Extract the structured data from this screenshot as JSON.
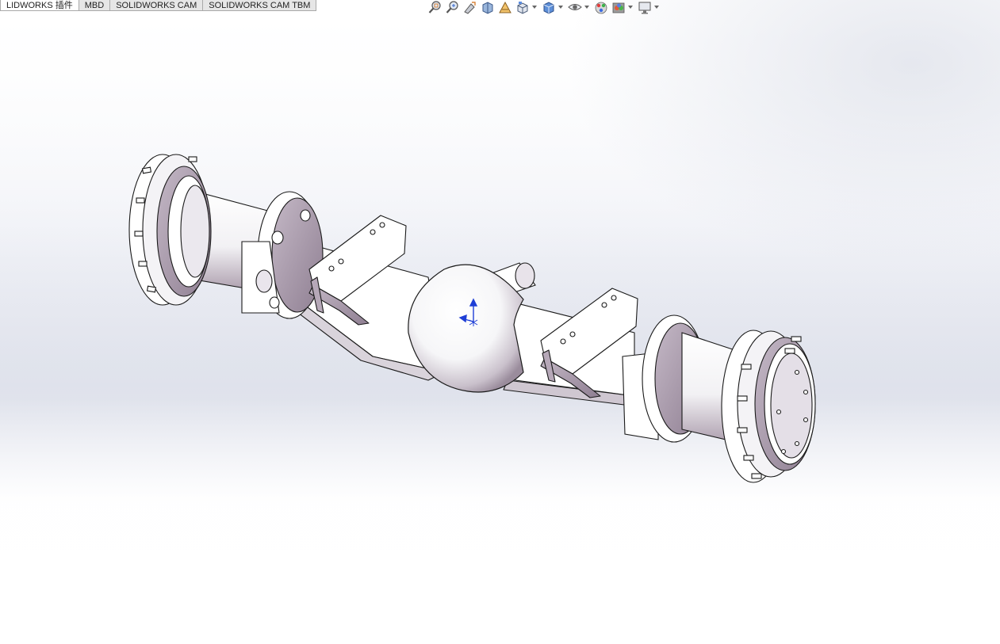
{
  "window": {
    "tabs": [
      {
        "label": "LIDWORKS 插件",
        "active": true
      },
      {
        "label": "MBD",
        "active": false
      },
      {
        "label": "SOLIDWORKS CAM",
        "active": false
      },
      {
        "label": "SOLIDWORKS CAM TBM",
        "active": false
      }
    ]
  },
  "heads_up_toolbar": {
    "icons": [
      "zoom-to-fit-icon",
      "zoom-to-area-icon",
      "previous-view-icon",
      "section-view-icon",
      "dynamic-annotation-icon",
      "view-orientation-icon",
      "display-style-icon",
      "hide-show-items-icon",
      "edit-appearance-icon",
      "apply-scene-icon",
      "view-settings-icon"
    ]
  },
  "colors": {
    "viewport_bg": "#ffffff",
    "model_face": "#ffffff",
    "model_shadow": "#a99aaa",
    "model_edge": "#1a1a1a",
    "triad_axis": "#1f3fd6"
  }
}
